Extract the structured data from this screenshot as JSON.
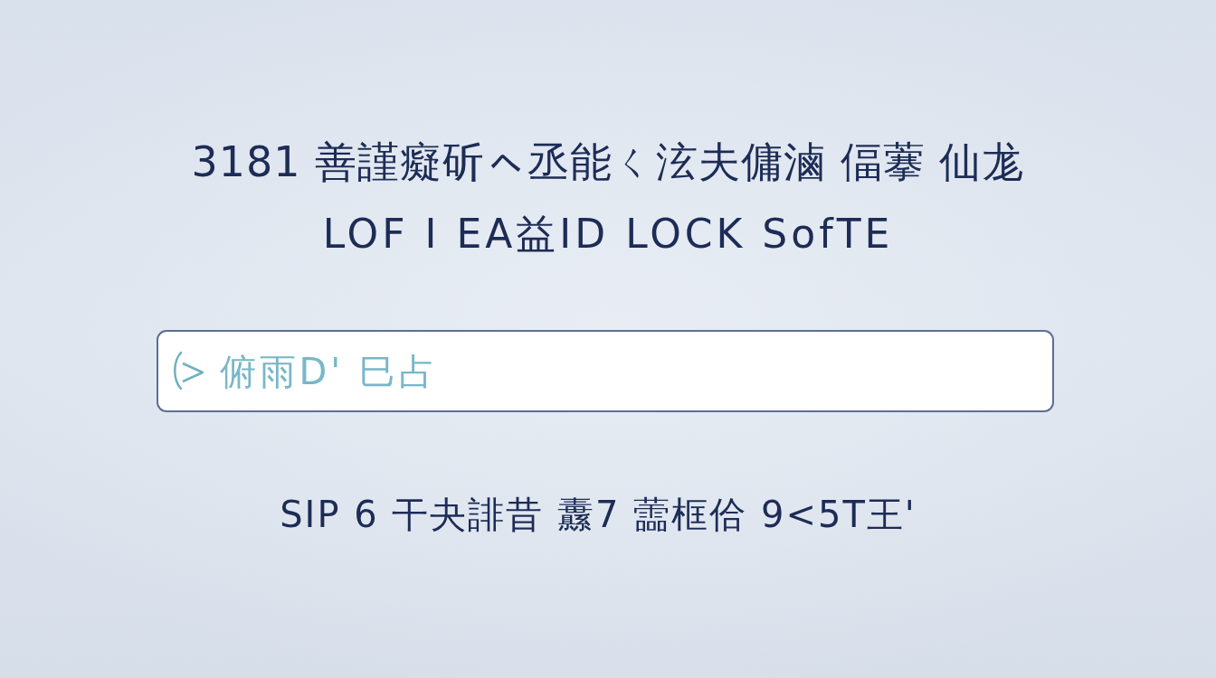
{
  "title": "3181 善謹癡斫ㇸ丞能ㄑ泫夫傭滷 偪藆 仙尨",
  "subtitle": "LOF I EA益ID LOCK SofTE",
  "field": {
    "placeholder": "俯雨D' 巳占"
  },
  "footer": "SIP 6 干夬誹昔 纛7 蘦框佮 9<5T王'"
}
